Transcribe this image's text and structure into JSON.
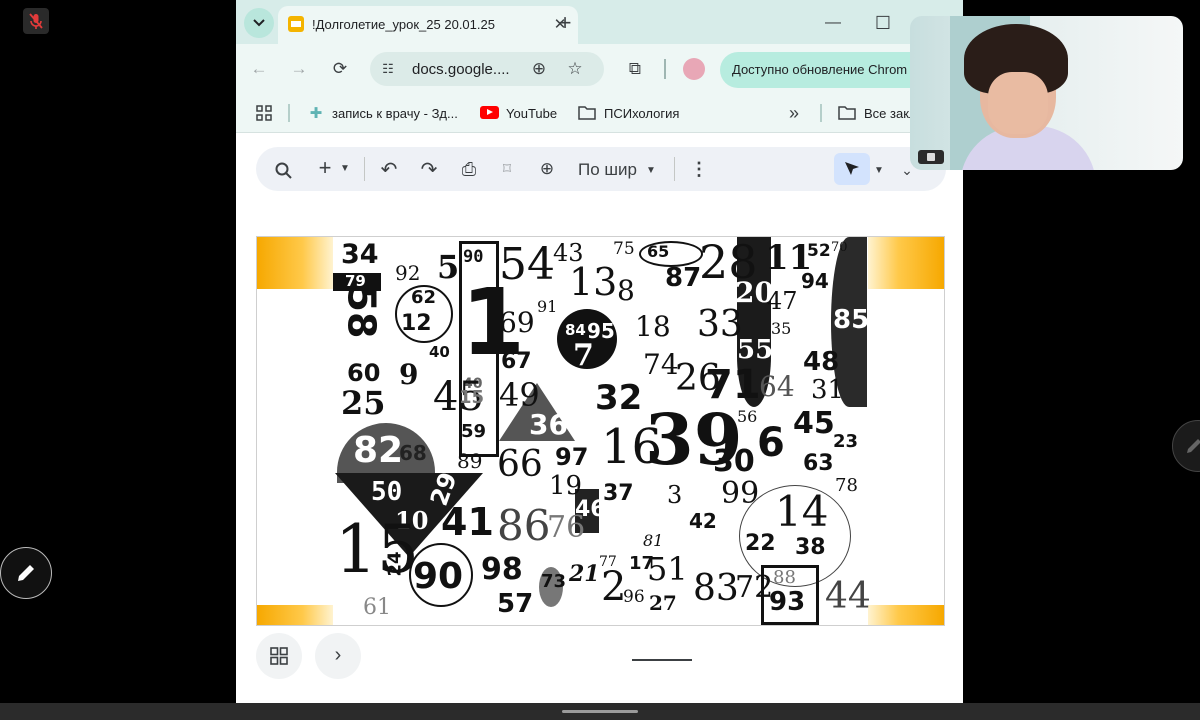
{
  "meeting": {
    "mic_state": "muted"
  },
  "browser": {
    "tab_title": "!Долголетие_урок_25 20.01.25",
    "new_tab_symbol": "+",
    "window_controls": {
      "minimize": "—",
      "maximize": "☐"
    },
    "address": "docs.google....",
    "update_button": "Доступно обновление Chrom",
    "bookmarks": [
      {
        "label": "запись к врачу - Зд...",
        "icon": "medical-icon"
      },
      {
        "label": "YouTube",
        "icon": "youtube-icon"
      },
      {
        "label": "ПСИхология",
        "icon": "folder-icon"
      },
      {
        "label": "Все закл",
        "icon": "folder-icon"
      }
    ],
    "bookmarks_overflow": "»"
  },
  "viewer": {
    "zoom_label": "По шир",
    "toolbar_icons": [
      "search-icon",
      "plus-icon",
      "undo-icon",
      "redo-icon",
      "print-icon",
      "format-paint-icon",
      "zoom-icon",
      "more-icon",
      "pointer-icon"
    ]
  },
  "slide": {
    "numbers": [
      "34",
      "79",
      "92",
      "5",
      "90",
      "1",
      "54",
      "43",
      "75",
      "65",
      "28",
      "11",
      "52",
      "70",
      "58",
      "62",
      "12",
      "69",
      "91",
      "13",
      "8",
      "87",
      "20",
      "94",
      "40",
      "40",
      "84",
      "95",
      "7",
      "18",
      "33",
      "47",
      "35",
      "85",
      "60",
      "9",
      "67",
      "74",
      "55",
      "48",
      "25",
      "45",
      "49",
      "36",
      "32",
      "26",
      "71",
      "64",
      "31",
      "82",
      "68",
      "15",
      "59",
      "56",
      "6",
      "45",
      "23",
      "89",
      "66",
      "97",
      "16",
      "39",
      "30",
      "63",
      "50",
      "29",
      "19",
      "37",
      "3",
      "99",
      "78",
      "10",
      "41",
      "86",
      "76",
      "46",
      "42",
      "14",
      "15",
      "24",
      "90",
      "98",
      "73",
      "21",
      "77",
      "51",
      "81",
      "22",
      "38",
      "61",
      "57",
      "2",
      "17",
      "96",
      "27",
      "83",
      "72",
      "88",
      "93",
      "44"
    ]
  },
  "colors": {
    "accent": "#d7ece9",
    "update_pill": "#b7ecdf",
    "slide_stripe": "#f6a800"
  }
}
